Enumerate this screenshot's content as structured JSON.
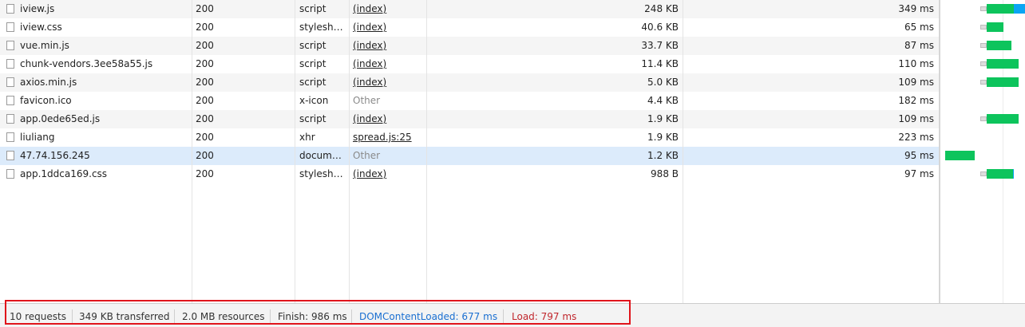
{
  "requests": [
    {
      "name": "iview.js",
      "status": "200",
      "type": "script",
      "initiator": "(index)",
      "initiator_link": true,
      "size": "248 KB",
      "time": "349 ms"
    },
    {
      "name": "iview.css",
      "status": "200",
      "type": "stylesheet",
      "initiator": "(index)",
      "initiator_link": true,
      "size": "40.6 KB",
      "time": "65 ms"
    },
    {
      "name": "vue.min.js",
      "status": "200",
      "type": "script",
      "initiator": "(index)",
      "initiator_link": true,
      "size": "33.7 KB",
      "time": "87 ms"
    },
    {
      "name": "chunk-vendors.3ee58a55.js",
      "status": "200",
      "type": "script",
      "initiator": "(index)",
      "initiator_link": true,
      "size": "11.4 KB",
      "time": "110 ms"
    },
    {
      "name": "axios.min.js",
      "status": "200",
      "type": "script",
      "initiator": "(index)",
      "initiator_link": true,
      "size": "5.0 KB",
      "time": "109 ms"
    },
    {
      "name": "favicon.ico",
      "status": "200",
      "type": "x-icon",
      "initiator": "Other",
      "initiator_link": false,
      "size": "4.4 KB",
      "time": "182 ms"
    },
    {
      "name": "app.0ede65ed.js",
      "status": "200",
      "type": "script",
      "initiator": "(index)",
      "initiator_link": true,
      "size": "1.9 KB",
      "time": "109 ms"
    },
    {
      "name": "liuliang",
      "status": "200",
      "type": "xhr",
      "initiator": "spread.js:25",
      "initiator_link": true,
      "size": "1.9 KB",
      "time": "223 ms"
    },
    {
      "name": "47.74.156.245",
      "status": "200",
      "type": "docume…",
      "initiator": "Other",
      "initiator_link": false,
      "size": "1.2 KB",
      "time": "95 ms"
    },
    {
      "name": "app.1ddca169.css",
      "status": "200",
      "type": "stylesheet",
      "initiator": "(index)",
      "initiator_link": true,
      "size": "988 B",
      "time": "97 ms"
    }
  ],
  "colors": {
    "waiting": "#0dc45c",
    "download": "#0aa5f3",
    "dom_content_loaded": "#1a6fd1",
    "load": "#c0262c"
  },
  "summary": {
    "requests": "10 requests",
    "transferred": "349 KB transferred",
    "resources": "2.0 MB resources",
    "finish": "Finish: 986 ms",
    "dom_content_loaded": "DOMContentLoaded: 677 ms",
    "load": "Load: 797 ms"
  }
}
